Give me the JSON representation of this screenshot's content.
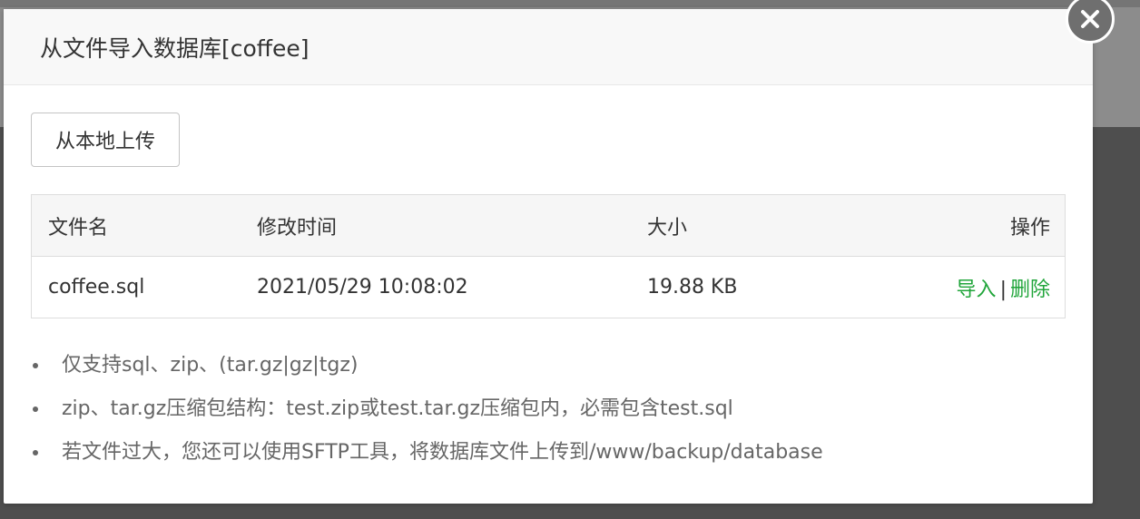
{
  "dialog": {
    "title": "从文件导入数据库[coffee]",
    "close_icon": "close-icon"
  },
  "toolbar": {
    "upload_label": "从本地上传"
  },
  "table": {
    "headers": [
      "文件名",
      "修改时间",
      "大小",
      "操作"
    ],
    "rows": [
      {
        "name": "coffee.sql",
        "modified": "2021/05/29 10:08:02",
        "size": "19.88 KB",
        "import_label": "导入",
        "separator": "|",
        "delete_label": "删除"
      }
    ]
  },
  "notes": [
    "仅支持sql、zip、(tar.gz|gz|tgz)",
    "zip、tar.gz压缩包结构：test.zip或test.tar.gz压缩包内，必需包含test.sql",
    "若文件过大，您还可以使用SFTP工具，将数据库文件上传到/www/backup/database"
  ],
  "colors": {
    "link": "#20a53a",
    "header_bg": "#f8f8f8",
    "overlay": "rgba(0,0,0,0.45)"
  }
}
